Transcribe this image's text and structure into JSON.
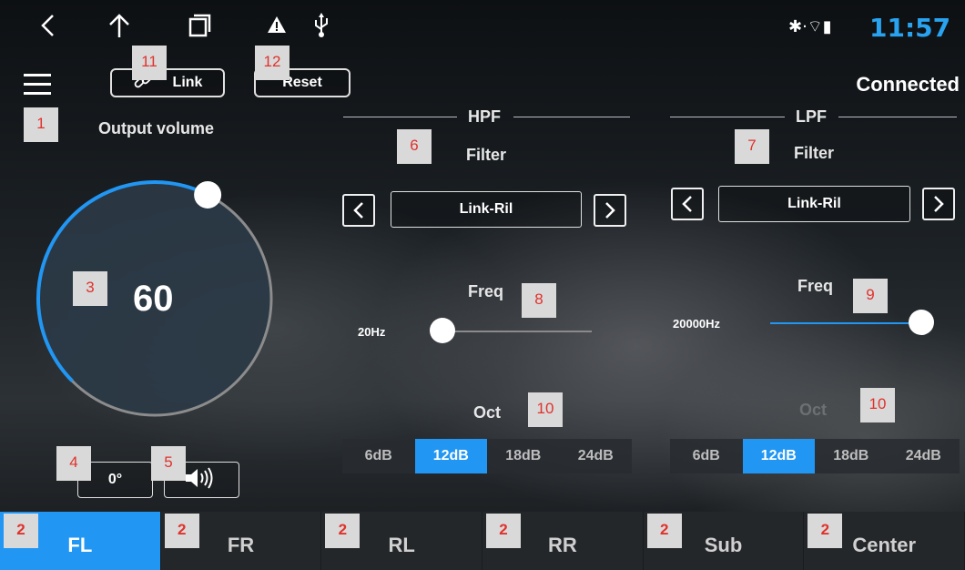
{
  "status_bar": {
    "back_icon": "chevron-left-icon",
    "home_icon": "home-icon",
    "recents_icon": "recents-icon",
    "warning_icon": "warning-icon",
    "usb_icon": "usb-icon",
    "indicators": "✱·⌔▮",
    "time": "11:57",
    "time_color": "#29a3f0"
  },
  "header": {
    "menu_icon": "hamburger-menu-icon",
    "link_button": "Link",
    "link_icon": "link-icon",
    "reset_button": "Reset",
    "connection_status": "Connected",
    "output_volume_label": "Output volume"
  },
  "markers": {
    "m1": "1",
    "m3": "3",
    "m4": "4",
    "m5": "5",
    "m6": "6",
    "m7": "7",
    "m8": "8",
    "m9": "9",
    "m10a": "10",
    "m10b": "10",
    "m11": "11",
    "m12": "12"
  },
  "volume": {
    "value": "60",
    "level_fraction": 0.6,
    "ring_color": "#2196f3",
    "phase_label": "0°",
    "speaker_icon": "speaker-volume-icon"
  },
  "hpf": {
    "title": "HPF",
    "filter_label": "Filter",
    "filter_value": "Link-Ril",
    "freq_label": "Freq",
    "freq_value": "20Hz",
    "slider_fraction": 0.0,
    "oct_label": "Oct",
    "slopes": [
      "6dB",
      "12dB",
      "18dB",
      "24dB"
    ],
    "selected_slope": "12dB"
  },
  "lpf": {
    "title": "LPF",
    "filter_label": "Filter",
    "filter_value": "Link-Ril",
    "freq_label": "Freq",
    "freq_value": "20000Hz",
    "slider_fraction": 1.0,
    "oct_label": "Oct",
    "slopes": [
      "6dB",
      "12dB",
      "18dB",
      "24dB"
    ],
    "selected_slope": "12dB"
  },
  "tabs": [
    {
      "label": "FL",
      "marker": "2",
      "active": true
    },
    {
      "label": "FR",
      "marker": "2",
      "active": false
    },
    {
      "label": "RL",
      "marker": "2",
      "active": false
    },
    {
      "label": "RR",
      "marker": "2",
      "active": false
    },
    {
      "label": "Sub",
      "marker": "2",
      "active": false
    },
    {
      "label": "Center",
      "marker": "2",
      "active": false
    }
  ],
  "accent_color": "#2196f3"
}
